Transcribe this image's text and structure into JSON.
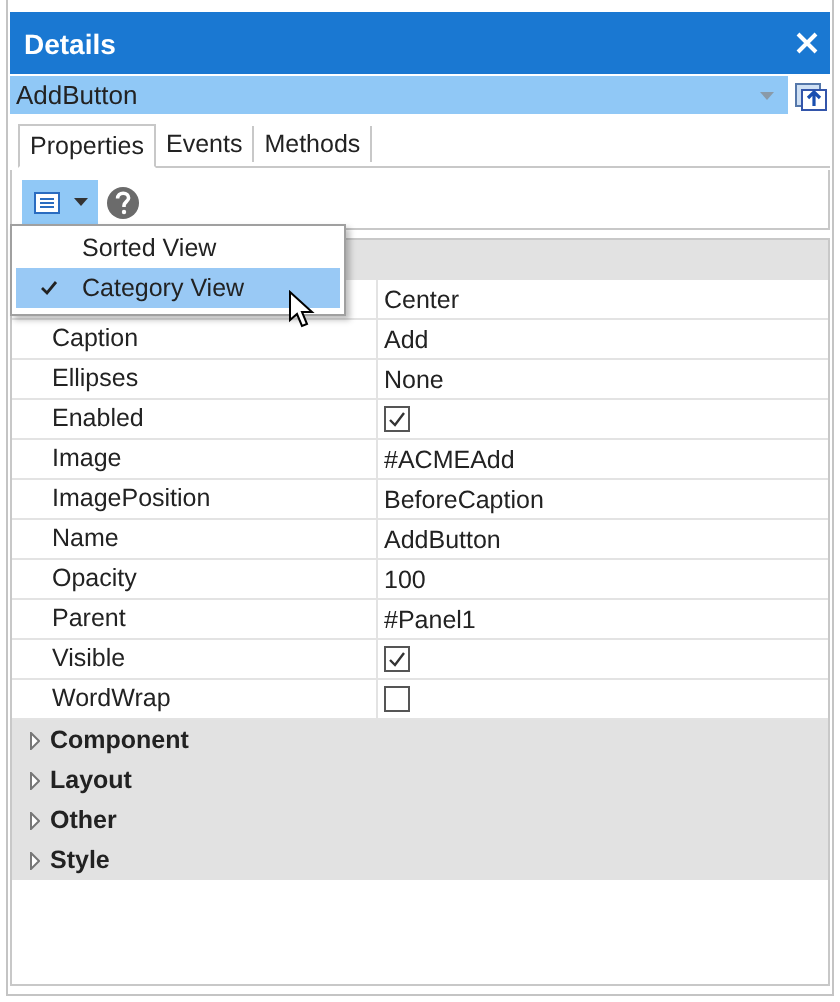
{
  "window": {
    "title": "Details"
  },
  "object_selector": {
    "value": "AddButton"
  },
  "tabs": [
    {
      "label": "Properties",
      "selected": true
    },
    {
      "label": "Events",
      "selected": false
    },
    {
      "label": "Methods",
      "selected": false
    }
  ],
  "view_menu": {
    "items": [
      {
        "label": "Sorted View",
        "checked": false,
        "selected": false
      },
      {
        "label": "Category View",
        "checked": true,
        "selected": true
      }
    ]
  },
  "grid": {
    "rows": [
      {
        "kind": "text",
        "value": "Center"
      },
      {
        "kind": "text",
        "name": "Caption",
        "value": "Add"
      },
      {
        "kind": "text",
        "name": "Ellipses",
        "value": "None"
      },
      {
        "kind": "checkbox",
        "name": "Enabled",
        "checked": true
      },
      {
        "kind": "text",
        "name": "Image",
        "value": "#ACMEAdd"
      },
      {
        "kind": "text",
        "name": "ImagePosition",
        "value": "BeforeCaption"
      },
      {
        "kind": "text",
        "name": "Name",
        "value": "AddButton"
      },
      {
        "kind": "text",
        "name": "Opacity",
        "value": "100"
      },
      {
        "kind": "text",
        "name": "Parent",
        "value": "#Panel1"
      },
      {
        "kind": "checkbox",
        "name": "Visible",
        "checked": true
      },
      {
        "kind": "checkbox",
        "name": "WordWrap",
        "checked": false
      }
    ],
    "categories": [
      {
        "label": "Component",
        "expanded": false
      },
      {
        "label": "Layout",
        "expanded": false
      },
      {
        "label": "Other",
        "expanded": false
      },
      {
        "label": "Style",
        "expanded": false
      }
    ]
  }
}
